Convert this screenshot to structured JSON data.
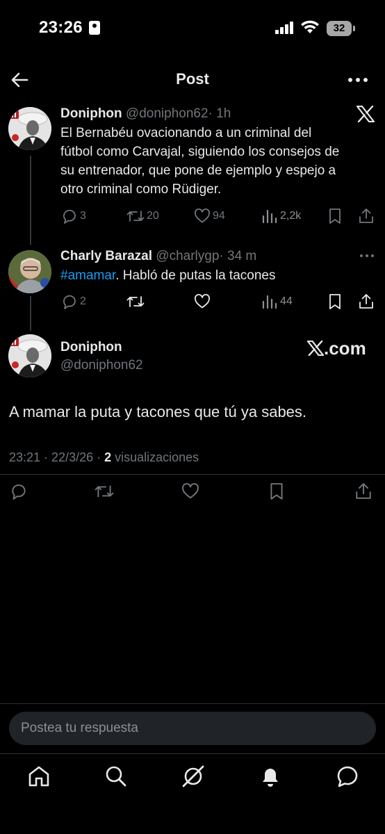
{
  "status_bar": {
    "time": "23:26",
    "battery": "32"
  },
  "header": {
    "title": "Post"
  },
  "tweets": [
    {
      "name": "Doniphon",
      "handle": "@doniphon62",
      "time": "· 1h",
      "lines": [
        "El Bernabéu ovacionando a un criminal del",
        "fútbol como Carvajal, siguiendo los consejos de",
        "su entrenador, que pone de ejemplo y espejo a",
        "otro criminal como Rüdiger."
      ],
      "replies": "3",
      "retweets": "20",
      "likes": "94",
      "views": "2,2k"
    },
    {
      "name": "Charly Barazal",
      "handle": "@charlygp",
      "time": "· 34 m",
      "hashtag": "#amamar",
      "text": ". Habló de putas la tacones",
      "replies": "2",
      "views": "44"
    }
  ],
  "main_post": {
    "name": "Doniphon",
    "handle": "@doniphon62",
    "watermark": ".com",
    "text": "A mamar la puta y tacones que tú ya sabes.",
    "timestamp": "23:21 · 22/3/26 · ",
    "views_count": "2",
    "views_label": " visualizaciones"
  },
  "reply_box": {
    "placeholder": "Postea tu respuesta"
  },
  "icons": {
    "back": "arrow-left-icon",
    "more": "more-horizontal-icon",
    "x_logo": "x-logo-icon",
    "reply": "reply-icon",
    "repost": "repost-icon",
    "like": "heart-icon",
    "views": "views-icon",
    "bookmark": "bookmark-icon",
    "share": "share-icon",
    "nav": [
      "home-icon",
      "search-icon",
      "grok-icon",
      "notifications-icon",
      "messages-icon"
    ]
  },
  "colors": {
    "background": "#000000",
    "text": "#e7e9ea",
    "secondary": "#71767b",
    "link": "#1d9bf0"
  }
}
